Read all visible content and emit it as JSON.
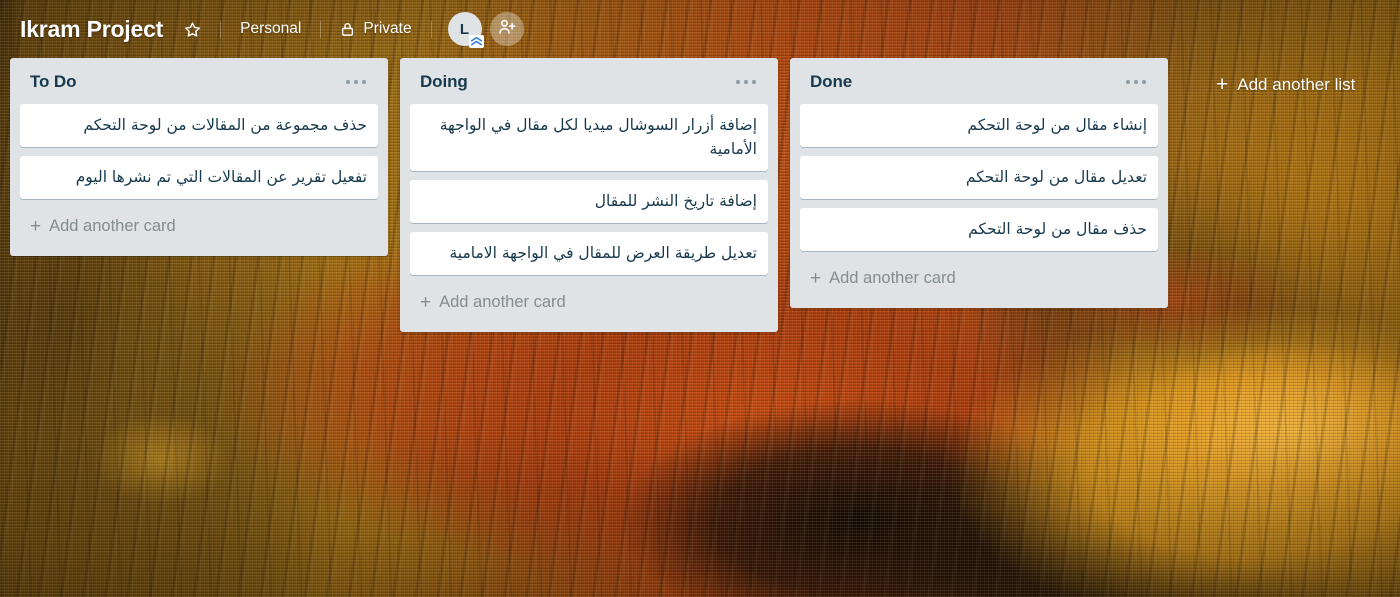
{
  "header": {
    "board_title": "Ikram Project",
    "star_icon": "star-icon",
    "team_label": "Personal",
    "lock_icon": "lock-icon",
    "visibility_label": "Private",
    "avatar_initial": "L",
    "avatar_badge_icon": "chevron-up-badge-icon",
    "add_member_icon": "person-add-icon"
  },
  "board": {
    "add_list_label": "Add another list",
    "add_list_icon": "plus-icon",
    "lists": [
      {
        "title": "To Do",
        "menu_icon": "list-menu-ellipsis-icon",
        "add_card_label": "Add another card",
        "cards": [
          {
            "text": "حذف مجموعة من المقالات من لوحة التحكم"
          },
          {
            "text": "تفعيل تقرير عن المقالات التي تم نشرها اليوم"
          }
        ]
      },
      {
        "title": "Doing",
        "menu_icon": "list-menu-ellipsis-icon",
        "add_card_label": "Add another card",
        "cards": [
          {
            "text": "إضافة أزرار السوشال ميديا لكل مقال في الواجهة الأمامية"
          },
          {
            "text": "إضافة تاريخ النشر للمقال"
          },
          {
            "text": "تعديل طريقة العرض للمقال في الواجهة الامامية"
          }
        ]
      },
      {
        "title": "Done",
        "menu_icon": "list-menu-ellipsis-icon",
        "add_card_label": "Add another card",
        "cards": [
          {
            "text": "إنشاء مقال من لوحة التحكم"
          },
          {
            "text": "تعديل مقال من لوحة التحكم"
          },
          {
            "text": "حذف مقال من لوحة التحكم"
          }
        ]
      }
    ]
  },
  "colors": {
    "list_background": "#dfe3e6",
    "card_background": "#ffffff",
    "text_dark": "#17394d",
    "text_muted": "#838c91",
    "header_text": "#ffffff",
    "background_primary": "#a4590f",
    "background_accent": "#e8a424"
  }
}
